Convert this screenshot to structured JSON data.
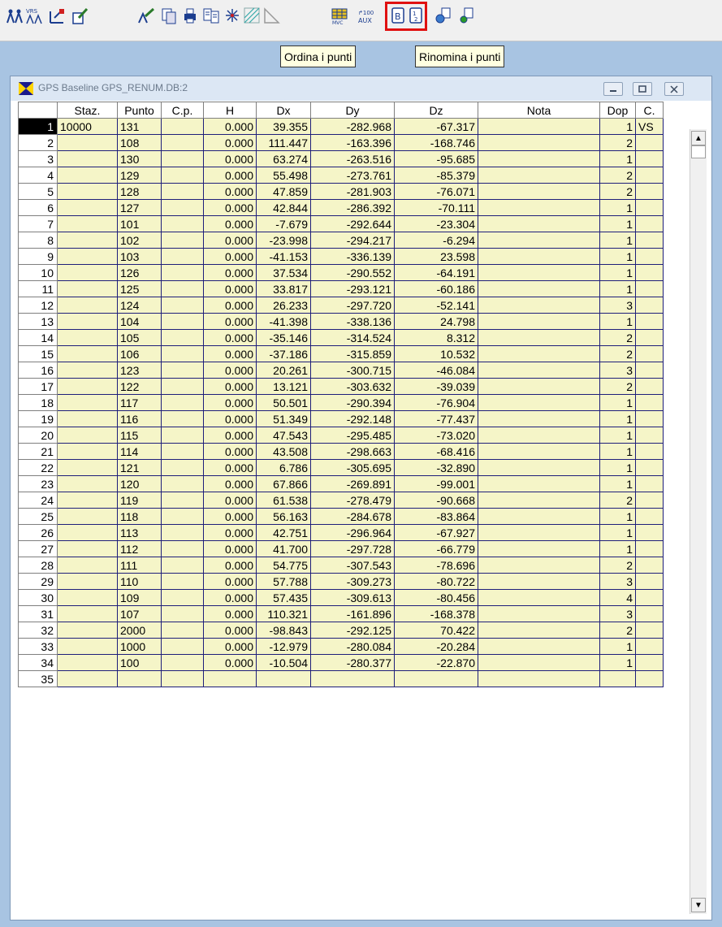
{
  "toolbar": {
    "tooltips": {
      "sort": "Ordina i punti",
      "rename": "Rinomina i punti"
    },
    "buttons": [
      {
        "name": "gps-stations-icon"
      },
      {
        "name": "vrs-icon"
      },
      {
        "name": "baseline-edit-icon"
      },
      {
        "name": "pen-document-icon"
      },
      {
        "name": "station-edit-icon"
      },
      {
        "name": "copy-points-icon"
      },
      {
        "name": "print-icon"
      },
      {
        "name": "document-table-icon"
      },
      {
        "name": "network-icon"
      },
      {
        "name": "grid-select-icon"
      },
      {
        "name": "triangle-icon"
      },
      {
        "name": "mvc-table-icon"
      },
      {
        "name": "aux-icon"
      },
      {
        "name": "sort-points-icon"
      },
      {
        "name": "rename-points-icon"
      },
      {
        "name": "export-globe-icon"
      },
      {
        "name": "export-point-icon"
      }
    ]
  },
  "window": {
    "title": "GPS Baseline GPS_RENUM.DB:2",
    "accent": "#ffd400"
  },
  "grid": {
    "columns": [
      "Staz.",
      "Punto",
      "C.p.",
      "H",
      "Dx",
      "Dy",
      "Dz",
      "Nota",
      "Dop",
      "C."
    ],
    "rows": [
      {
        "n": "1",
        "staz": "10000",
        "punto": "131",
        "cp": "",
        "h": "0.000",
        "dx": "39.355",
        "dy": "-282.968",
        "dz": "-67.317",
        "nota": "",
        "dop": "1",
        "c": "VS"
      },
      {
        "n": "2",
        "staz": "",
        "punto": "108",
        "cp": "",
        "h": "0.000",
        "dx": "111.447",
        "dy": "-163.396",
        "dz": "-168.746",
        "nota": "",
        "dop": "2",
        "c": ""
      },
      {
        "n": "3",
        "staz": "",
        "punto": "130",
        "cp": "",
        "h": "0.000",
        "dx": "63.274",
        "dy": "-263.516",
        "dz": "-95.685",
        "nota": "",
        "dop": "1",
        "c": ""
      },
      {
        "n": "4",
        "staz": "",
        "punto": "129",
        "cp": "",
        "h": "0.000",
        "dx": "55.498",
        "dy": "-273.761",
        "dz": "-85.379",
        "nota": "",
        "dop": "2",
        "c": ""
      },
      {
        "n": "5",
        "staz": "",
        "punto": "128",
        "cp": "",
        "h": "0.000",
        "dx": "47.859",
        "dy": "-281.903",
        "dz": "-76.071",
        "nota": "",
        "dop": "2",
        "c": ""
      },
      {
        "n": "6",
        "staz": "",
        "punto": "127",
        "cp": "",
        "h": "0.000",
        "dx": "42.844",
        "dy": "-286.392",
        "dz": "-70.111",
        "nota": "",
        "dop": "1",
        "c": ""
      },
      {
        "n": "7",
        "staz": "",
        "punto": "101",
        "cp": "",
        "h": "0.000",
        "dx": "-7.679",
        "dy": "-292.644",
        "dz": "-23.304",
        "nota": "",
        "dop": "1",
        "c": ""
      },
      {
        "n": "8",
        "staz": "",
        "punto": "102",
        "cp": "",
        "h": "0.000",
        "dx": "-23.998",
        "dy": "-294.217",
        "dz": "-6.294",
        "nota": "",
        "dop": "1",
        "c": ""
      },
      {
        "n": "9",
        "staz": "",
        "punto": "103",
        "cp": "",
        "h": "0.000",
        "dx": "-41.153",
        "dy": "-336.139",
        "dz": "23.598",
        "nota": "",
        "dop": "1",
        "c": ""
      },
      {
        "n": "10",
        "staz": "",
        "punto": "126",
        "cp": "",
        "h": "0.000",
        "dx": "37.534",
        "dy": "-290.552",
        "dz": "-64.191",
        "nota": "",
        "dop": "1",
        "c": ""
      },
      {
        "n": "11",
        "staz": "",
        "punto": "125",
        "cp": "",
        "h": "0.000",
        "dx": "33.817",
        "dy": "-293.121",
        "dz": "-60.186",
        "nota": "",
        "dop": "1",
        "c": ""
      },
      {
        "n": "12",
        "staz": "",
        "punto": "124",
        "cp": "",
        "h": "0.000",
        "dx": "26.233",
        "dy": "-297.720",
        "dz": "-52.141",
        "nota": "",
        "dop": "3",
        "c": ""
      },
      {
        "n": "13",
        "staz": "",
        "punto": "104",
        "cp": "",
        "h": "0.000",
        "dx": "-41.398",
        "dy": "-338.136",
        "dz": "24.798",
        "nota": "",
        "dop": "1",
        "c": ""
      },
      {
        "n": "14",
        "staz": "",
        "punto": "105",
        "cp": "",
        "h": "0.000",
        "dx": "-35.146",
        "dy": "-314.524",
        "dz": "8.312",
        "nota": "",
        "dop": "2",
        "c": ""
      },
      {
        "n": "15",
        "staz": "",
        "punto": "106",
        "cp": "",
        "h": "0.000",
        "dx": "-37.186",
        "dy": "-315.859",
        "dz": "10.532",
        "nota": "",
        "dop": "2",
        "c": ""
      },
      {
        "n": "16",
        "staz": "",
        "punto": "123",
        "cp": "",
        "h": "0.000",
        "dx": "20.261",
        "dy": "-300.715",
        "dz": "-46.084",
        "nota": "",
        "dop": "3",
        "c": ""
      },
      {
        "n": "17",
        "staz": "",
        "punto": "122",
        "cp": "",
        "h": "0.000",
        "dx": "13.121",
        "dy": "-303.632",
        "dz": "-39.039",
        "nota": "",
        "dop": "2",
        "c": ""
      },
      {
        "n": "18",
        "staz": "",
        "punto": "117",
        "cp": "",
        "h": "0.000",
        "dx": "50.501",
        "dy": "-290.394",
        "dz": "-76.904",
        "nota": "",
        "dop": "1",
        "c": ""
      },
      {
        "n": "19",
        "staz": "",
        "punto": "116",
        "cp": "",
        "h": "0.000",
        "dx": "51.349",
        "dy": "-292.148",
        "dz": "-77.437",
        "nota": "",
        "dop": "1",
        "c": ""
      },
      {
        "n": "20",
        "staz": "",
        "punto": "115",
        "cp": "",
        "h": "0.000",
        "dx": "47.543",
        "dy": "-295.485",
        "dz": "-73.020",
        "nota": "",
        "dop": "1",
        "c": ""
      },
      {
        "n": "21",
        "staz": "",
        "punto": "114",
        "cp": "",
        "h": "0.000",
        "dx": "43.508",
        "dy": "-298.663",
        "dz": "-68.416",
        "nota": "",
        "dop": "1",
        "c": ""
      },
      {
        "n": "22",
        "staz": "",
        "punto": "121",
        "cp": "",
        "h": "0.000",
        "dx": "6.786",
        "dy": "-305.695",
        "dz": "-32.890",
        "nota": "",
        "dop": "1",
        "c": ""
      },
      {
        "n": "23",
        "staz": "",
        "punto": "120",
        "cp": "",
        "h": "0.000",
        "dx": "67.866",
        "dy": "-269.891",
        "dz": "-99.001",
        "nota": "",
        "dop": "1",
        "c": ""
      },
      {
        "n": "24",
        "staz": "",
        "punto": "119",
        "cp": "",
        "h": "0.000",
        "dx": "61.538",
        "dy": "-278.479",
        "dz": "-90.668",
        "nota": "",
        "dop": "2",
        "c": ""
      },
      {
        "n": "25",
        "staz": "",
        "punto": "118",
        "cp": "",
        "h": "0.000",
        "dx": "56.163",
        "dy": "-284.678",
        "dz": "-83.864",
        "nota": "",
        "dop": "1",
        "c": ""
      },
      {
        "n": "26",
        "staz": "",
        "punto": "113",
        "cp": "",
        "h": "0.000",
        "dx": "42.751",
        "dy": "-296.964",
        "dz": "-67.927",
        "nota": "",
        "dop": "1",
        "c": ""
      },
      {
        "n": "27",
        "staz": "",
        "punto": "112",
        "cp": "",
        "h": "0.000",
        "dx": "41.700",
        "dy": "-297.728",
        "dz": "-66.779",
        "nota": "",
        "dop": "1",
        "c": ""
      },
      {
        "n": "28",
        "staz": "",
        "punto": "111",
        "cp": "",
        "h": "0.000",
        "dx": "54.775",
        "dy": "-307.543",
        "dz": "-78.696",
        "nota": "",
        "dop": "2",
        "c": ""
      },
      {
        "n": "29",
        "staz": "",
        "punto": "110",
        "cp": "",
        "h": "0.000",
        "dx": "57.788",
        "dy": "-309.273",
        "dz": "-80.722",
        "nota": "",
        "dop": "3",
        "c": ""
      },
      {
        "n": "30",
        "staz": "",
        "punto": "109",
        "cp": "",
        "h": "0.000",
        "dx": "57.435",
        "dy": "-309.613",
        "dz": "-80.456",
        "nota": "",
        "dop": "4",
        "c": ""
      },
      {
        "n": "31",
        "staz": "",
        "punto": "107",
        "cp": "",
        "h": "0.000",
        "dx": "110.321",
        "dy": "-161.896",
        "dz": "-168.378",
        "nota": "",
        "dop": "3",
        "c": ""
      },
      {
        "n": "32",
        "staz": "",
        "punto": "2000",
        "cp": "",
        "h": "0.000",
        "dx": "-98.843",
        "dy": "-292.125",
        "dz": "70.422",
        "nota": "",
        "dop": "2",
        "c": ""
      },
      {
        "n": "33",
        "staz": "",
        "punto": "1000",
        "cp": "",
        "h": "0.000",
        "dx": "-12.979",
        "dy": "-280.084",
        "dz": "-20.284",
        "nota": "",
        "dop": "1",
        "c": ""
      },
      {
        "n": "34",
        "staz": "",
        "punto": "100",
        "cp": "",
        "h": "0.000",
        "dx": "-10.504",
        "dy": "-280.377",
        "dz": "-22.870",
        "nota": "",
        "dop": "1",
        "c": ""
      },
      {
        "n": "35",
        "staz": "",
        "punto": "",
        "cp": "",
        "h": "",
        "dx": "",
        "dy": "",
        "dz": "",
        "nota": "",
        "dop": "",
        "c": ""
      }
    ]
  }
}
